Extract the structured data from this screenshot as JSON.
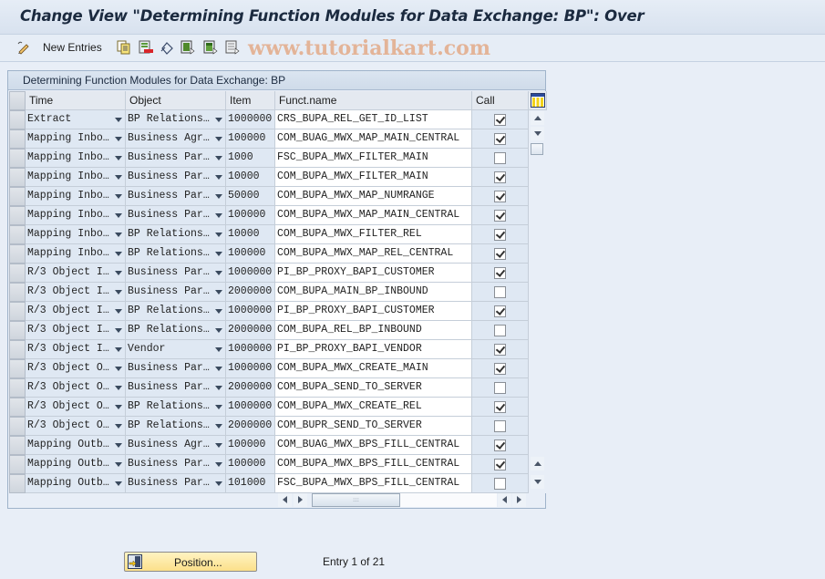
{
  "window": {
    "title": "Change View \"Determining Function Modules for Data Exchange: BP\": Over"
  },
  "toolbar": {
    "new_entries_label": "New Entries",
    "icons": [
      "edit-toggle-icon",
      "copy-as-icon",
      "delete-icon",
      "undo-change-icon",
      "select-all-icon",
      "select-block-icon",
      "deselect-all-icon"
    ],
    "watermark": "www.tutorialkart.com"
  },
  "table": {
    "title": "Determining Function Modules for Data Exchange: BP",
    "columns": [
      "Time",
      "Object",
      "Item",
      "Funct.name",
      "Call"
    ],
    "rows": [
      {
        "time": "Extract",
        "object": "BP Relations…",
        "item": "1000000",
        "funct": "CRS_BUPA_REL_GET_ID_LIST",
        "call": true
      },
      {
        "time": "Mapping Inbo…",
        "object": "Business Agr…",
        "item": "100000",
        "funct": "COM_BUAG_MWX_MAP_MAIN_CENTRAL",
        "call": true
      },
      {
        "time": "Mapping Inbo…",
        "object": "Business Par…",
        "item": "1000",
        "funct": "FSC_BUPA_MWX_FILTER_MAIN",
        "call": false
      },
      {
        "time": "Mapping Inbo…",
        "object": "Business Par…",
        "item": "10000",
        "funct": "COM_BUPA_MWX_FILTER_MAIN",
        "call": true
      },
      {
        "time": "Mapping Inbo…",
        "object": "Business Par…",
        "item": "50000",
        "funct": "COM_BUPA_MWX_MAP_NUMRANGE",
        "call": true
      },
      {
        "time": "Mapping Inbo…",
        "object": "Business Par…",
        "item": "100000",
        "funct": "COM_BUPA_MWX_MAP_MAIN_CENTRAL",
        "call": true
      },
      {
        "time": "Mapping Inbo…",
        "object": "BP Relations…",
        "item": "10000",
        "funct": "COM_BUPA_MWX_FILTER_REL",
        "call": true
      },
      {
        "time": "Mapping Inbo…",
        "object": "BP Relations…",
        "item": "100000",
        "funct": "COM_BUPA_MWX_MAP_REL_CENTRAL",
        "call": true
      },
      {
        "time": "R/3 Object I…",
        "object": "Business Par…",
        "item": "1000000",
        "funct": "PI_BP_PROXY_BAPI_CUSTOMER",
        "call": true
      },
      {
        "time": "R/3 Object I…",
        "object": "Business Par…",
        "item": "2000000",
        "funct": "COM_BUPA_MAIN_BP_INBOUND",
        "call": false
      },
      {
        "time": "R/3 Object I…",
        "object": "BP Relations…",
        "item": "1000000",
        "funct": "PI_BP_PROXY_BAPI_CUSTOMER",
        "call": true
      },
      {
        "time": "R/3 Object I…",
        "object": "BP Relations…",
        "item": "2000000",
        "funct": "COM_BUPA_REL_BP_INBOUND",
        "call": false
      },
      {
        "time": "R/3 Object I…",
        "object": "Vendor",
        "item": "1000000",
        "funct": "PI_BP_PROXY_BAPI_VENDOR",
        "call": true
      },
      {
        "time": "R/3 Object O…",
        "object": "Business Par…",
        "item": "1000000",
        "funct": "COM_BUPA_MWX_CREATE_MAIN",
        "call": true
      },
      {
        "time": "R/3 Object O…",
        "object": "Business Par…",
        "item": "2000000",
        "funct": "COM_BUPA_SEND_TO_SERVER",
        "call": false
      },
      {
        "time": "R/3 Object O…",
        "object": "BP Relations…",
        "item": "1000000",
        "funct": "COM_BUPA_MWX_CREATE_REL",
        "call": true
      },
      {
        "time": "R/3 Object O…",
        "object": "BP Relations…",
        "item": "2000000",
        "funct": "COM_BUPR_SEND_TO_SERVER",
        "call": false
      },
      {
        "time": "Mapping Outb…",
        "object": "Business Agr…",
        "item": "100000",
        "funct": "COM_BUAG_MWX_BPS_FILL_CENTRAL",
        "call": true
      },
      {
        "time": "Mapping Outb…",
        "object": "Business Par…",
        "item": "100000",
        "funct": "COM_BUPA_MWX_BPS_FILL_CENTRAL",
        "call": true
      },
      {
        "time": "Mapping Outb…",
        "object": "Business Par…",
        "item": "101000",
        "funct": "FSC_BUPA_MWX_BPS_FILL_CENTRAL",
        "call": false
      }
    ]
  },
  "footer": {
    "position_label": "Position...",
    "entry_text": "Entry 1 of 21"
  }
}
